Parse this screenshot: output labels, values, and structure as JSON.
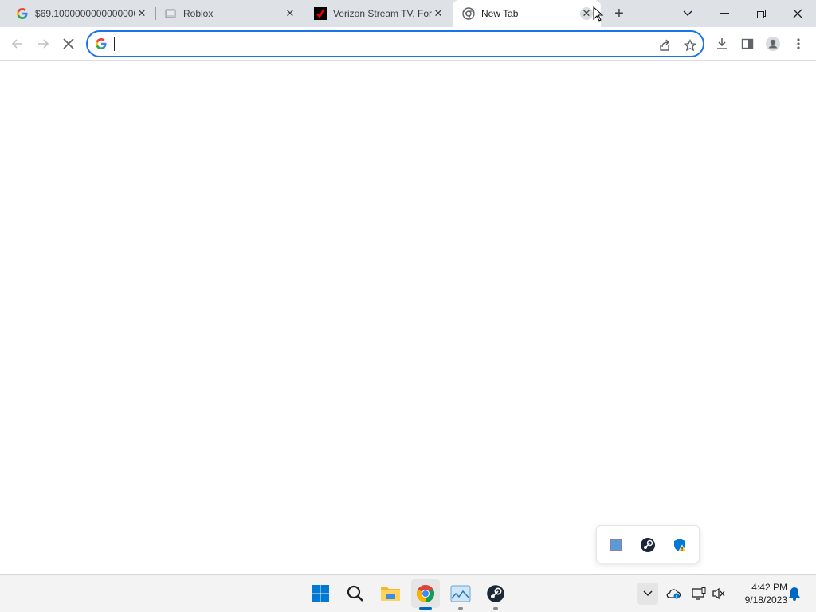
{
  "browser": {
    "tabs": [
      {
        "title": "$69.10000000000000000",
        "favicon": "google-g-icon",
        "active": false
      },
      {
        "title": "Roblox",
        "favicon": "roblox-icon",
        "active": false
      },
      {
        "title": "Verizon Stream TV, For",
        "favicon": "verizon-check-icon",
        "active": false
      },
      {
        "title": "New Tab",
        "favicon": "chrome-newtab-icon",
        "active": true
      }
    ],
    "new_tab_symbol": "+",
    "close_symbol": "✕",
    "window_controls": {
      "tab_search": "search-tabs-icon",
      "minimize": "minimize-icon",
      "restore": "restore-icon",
      "close": "window-close-icon"
    },
    "address_bar": {
      "value": "",
      "placeholder": "",
      "search_engine_icon": "google-g-icon"
    },
    "toolbar_icons": [
      "back-icon",
      "forward-icon",
      "stop-loading-icon",
      "share-icon",
      "bookmark-star-icon",
      "download-icon",
      "side-panel-icon",
      "profile-icon",
      "menu-icon"
    ]
  },
  "tray_flyout": {
    "icons": [
      "app-square-icon",
      "steam-icon",
      "defender-warning-icon"
    ]
  },
  "taskbar": {
    "apps": [
      {
        "name": "start",
        "icon": "windows-start-icon",
        "running": false
      },
      {
        "name": "search",
        "icon": "search-icon",
        "running": false
      },
      {
        "name": "file-explorer",
        "icon": "folder-icon",
        "running": false
      },
      {
        "name": "chrome",
        "icon": "chrome-icon",
        "running": true,
        "active": true
      },
      {
        "name": "photos",
        "icon": "photos-icon",
        "running": true
      },
      {
        "name": "steam",
        "icon": "steam-icon",
        "running": true
      }
    ],
    "tray": {
      "chevron": "show-hidden-icons-chevron",
      "time": "4:42 PM",
      "date": "9/18/2023"
    }
  },
  "colors": {
    "tabstrip_bg": "#dee1e6",
    "accent": "#1a73e8",
    "taskbar_bg": "#f3f3f3",
    "active_indicator": "#0067c0"
  }
}
